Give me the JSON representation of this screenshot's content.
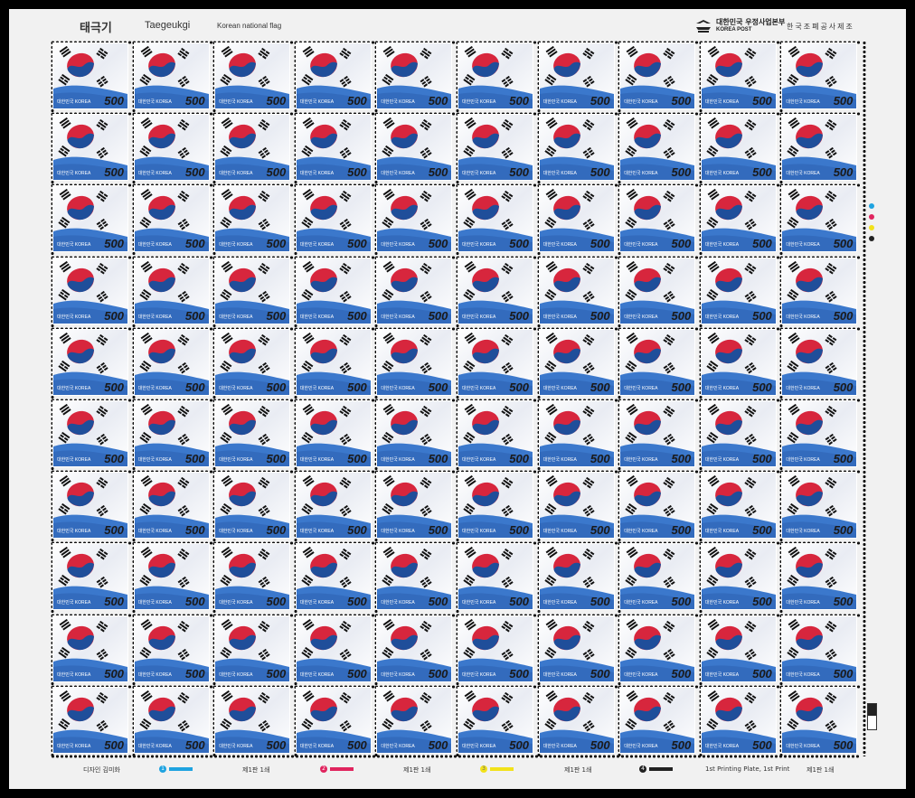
{
  "header": {
    "title_ko": "태극기",
    "title_en": "Taegeukgi",
    "subtitle": "Korean national flag",
    "post_name": "대한민국 우정사업본부",
    "post_en": "KOREA POST",
    "printer": "한국조폐공사제조"
  },
  "stamp": {
    "denomination": "500",
    "country": "대한민국 KOREA",
    "rows": 10,
    "cols": 10
  },
  "footer": {
    "designer": "디자인 김미화",
    "plate1_num": "1",
    "plate2_num": "2",
    "plate3_num": "3",
    "plate4_num": "4",
    "print1": "제1판 1쇄",
    "print2": "제1판 1쇄",
    "print3": "제1판 1쇄",
    "print_en": "1st Printing Plate, 1st Print",
    "print4": "제1판 1쇄"
  },
  "colors": {
    "cyan": "#1fa3e0",
    "magenta": "#e0245e",
    "yellow": "#f2e21a",
    "black": "#222222",
    "flag_red": "#d7263d",
    "flag_blue": "#1f4e9a",
    "band_blue": "#3b78cc"
  }
}
